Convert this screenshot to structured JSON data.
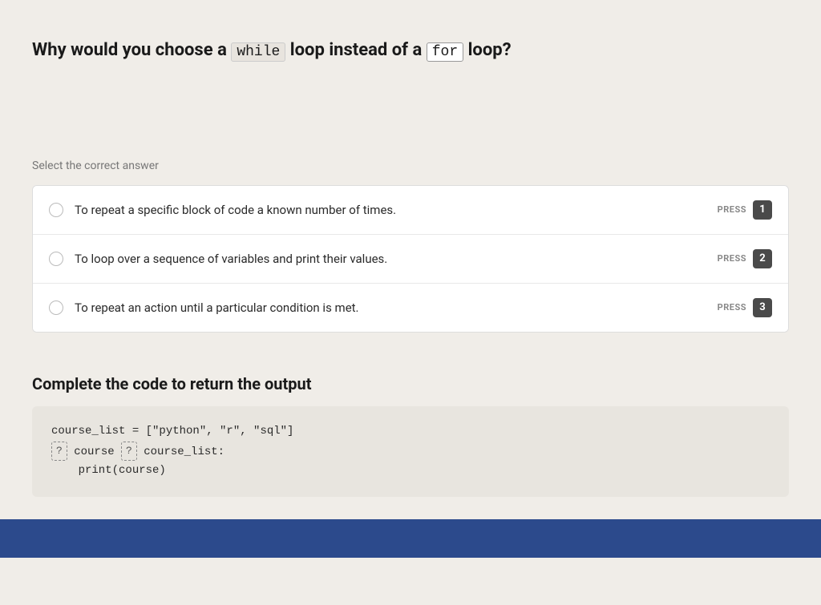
{
  "question": {
    "title_prefix": "Why would you choose a ",
    "while_code": "while",
    "title_middle": " loop instead of a ",
    "for_code": "for",
    "title_suffix": " loop?"
  },
  "answer_section": {
    "label": "Select the correct answer",
    "options": [
      {
        "id": 1,
        "text": "To repeat a specific block of code a known number of times.",
        "press_label": "PRESS",
        "press_number": "1"
      },
      {
        "id": 2,
        "text": "To loop over a sequence of variables and print their values.",
        "press_label": "PRESS",
        "press_number": "2"
      },
      {
        "id": 3,
        "text": "To repeat an action until a particular condition is met.",
        "press_label": "PRESS",
        "press_number": "3"
      }
    ]
  },
  "code_section": {
    "title": "Complete the code to return the output",
    "code_lines": [
      "course_list = [\"python\", \"r\", \"sql\"]",
      "",
      "    print(course)"
    ],
    "line2_prefix": "",
    "placeholder1": "?",
    "placeholder2": "?",
    "line2_middle": " course ",
    "line2_suffix": " course_list:"
  }
}
